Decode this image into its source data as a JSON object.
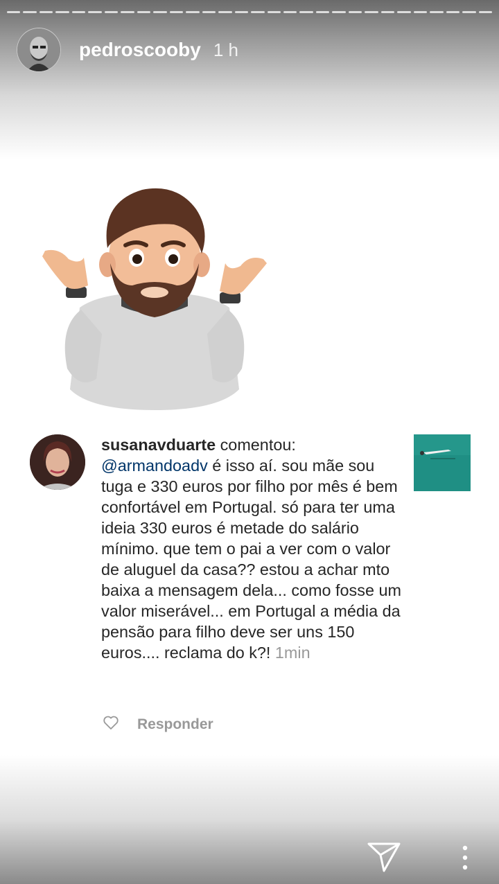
{
  "story": {
    "username": "pedroscooby",
    "time": "1 h",
    "progress_segments": 3
  },
  "comment": {
    "author": "susanavduarte",
    "action": "comentou:",
    "mention": "@armandoadv",
    "text": "é isso aí. sou mãe sou tuga e 330 euros por filho por mês é bem confortável em Portugal. só para ter uma ideia 330 euros é metade do salário mínimo. que tem o pai a ver com o valor de aluguel da casa?? estou a achar mto baixa a mensagem dela... como fosse um valor miserável... em Portugal a média da pensão para filho deve ser uns 150 euros.... reclama do k?!",
    "timestamp": "1min",
    "reply_label": "Responder"
  },
  "icons": {
    "like": "heart-outline-icon",
    "share": "paper-plane-icon",
    "more": "vertical-dots-icon"
  },
  "colors": {
    "mention": "#003569",
    "text": "#262626",
    "muted": "#999999"
  }
}
